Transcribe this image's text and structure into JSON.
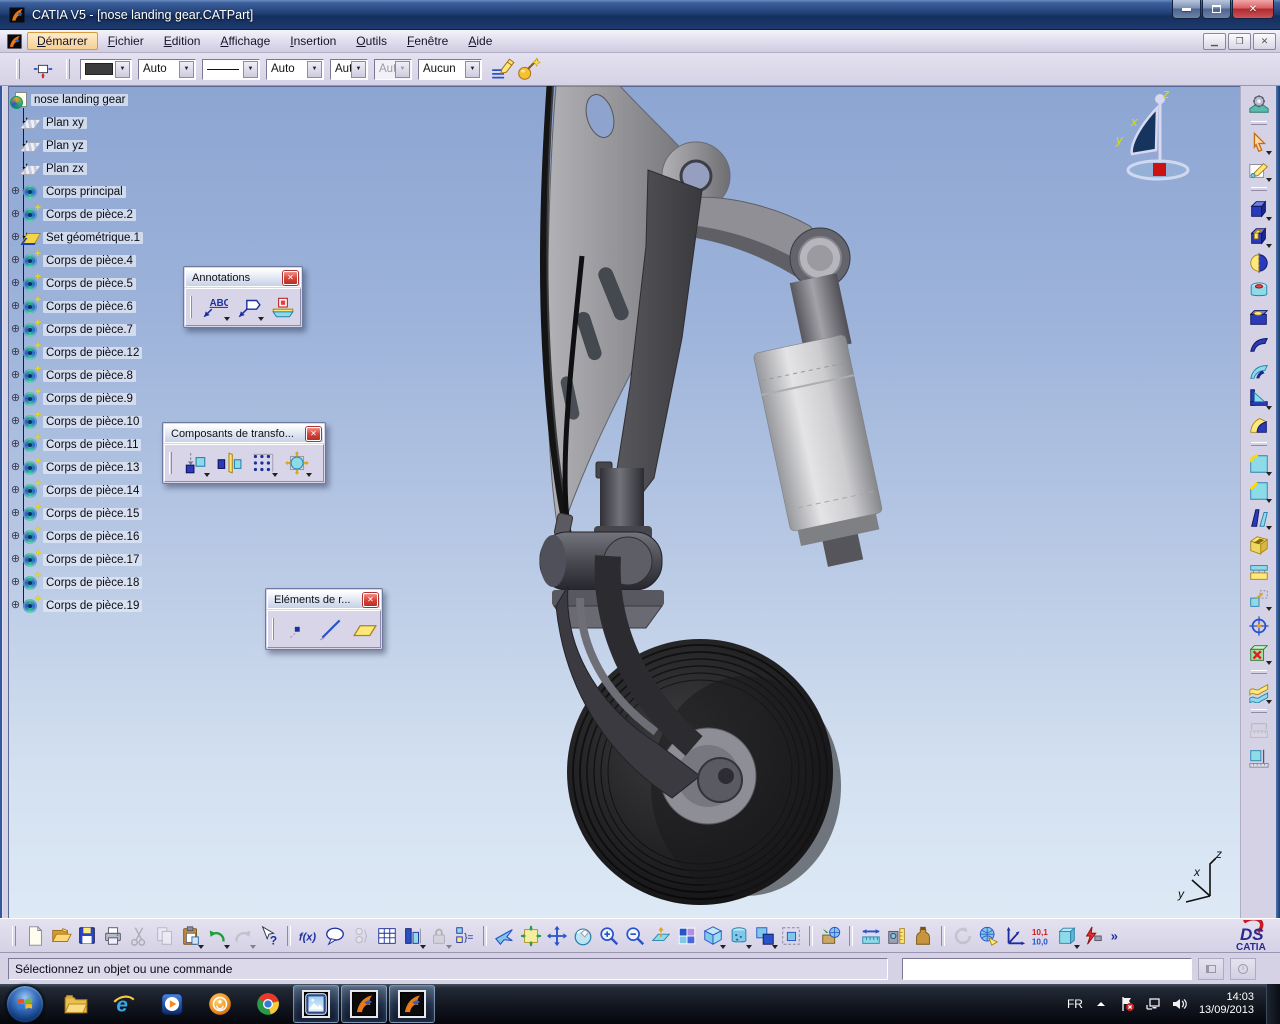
{
  "window": {
    "title": "CATIA V5 - [nose landing gear.CATPart]"
  },
  "menu": {
    "items": [
      {
        "label": "Démarrer",
        "cls": "hl",
        "name": "menu-demarrer"
      },
      {
        "label": "Fichier",
        "name": "menu-fichier"
      },
      {
        "label": "Edition",
        "name": "menu-edition"
      },
      {
        "label": "Affichage",
        "name": "menu-affichage"
      },
      {
        "label": "Insertion",
        "name": "menu-insertion"
      },
      {
        "label": "Outils",
        "name": "menu-outils"
      },
      {
        "label": "Fenêtre",
        "name": "menu-fenetre"
      },
      {
        "label": "Aide",
        "name": "menu-aide"
      }
    ]
  },
  "graphic_toolbar": {
    "combos": [
      {
        "name": "fill-color-combo",
        "cls": "swatch sw",
        "value": ""
      },
      {
        "name": "transparency-combo",
        "cls": "m",
        "value": "Auto"
      },
      {
        "name": "line-type-combo",
        "cls": "line m",
        "value": ""
      },
      {
        "name": "line-weight-combo",
        "cls": "m",
        "value": "Auto"
      },
      {
        "name": "point-style-combo",
        "cls": "s",
        "value": "Aut"
      },
      {
        "name": "render-style-combo",
        "cls": "s disabled",
        "value": "Aut"
      },
      {
        "name": "layer-combo",
        "cls": "l",
        "value": "Aucun"
      }
    ]
  },
  "tree": {
    "root": {
      "label": "nose landing gear"
    },
    "items": [
      {
        "label": "Plan xy",
        "icon": "plane",
        "expcls": "hide",
        "name": "tree-plan-xy"
      },
      {
        "label": "Plan yz",
        "icon": "plane",
        "expcls": "hide",
        "name": "tree-plan-yz"
      },
      {
        "label": "Plan zx",
        "icon": "plane",
        "expcls": "hide",
        "name": "tree-plan-zx"
      },
      {
        "label": "Corps principal",
        "icon": "body",
        "expcls": "show",
        "name": "tree-corps-principal"
      },
      {
        "label": "Corps de pièce.2",
        "icon": "bodyplus",
        "expcls": "show",
        "name": "tree-corps-2"
      },
      {
        "label": "Set géométrique.1",
        "icon": "geoset",
        "expcls": "show",
        "name": "tree-set-geometrique-1"
      },
      {
        "label": "Corps de pièce.4",
        "icon": "bodyplus",
        "expcls": "show",
        "name": "tree-corps-4"
      },
      {
        "label": "Corps de pièce.5",
        "icon": "bodyplus",
        "expcls": "show",
        "name": "tree-corps-5"
      },
      {
        "label": "Corps de pièce.6",
        "icon": "bodyplus",
        "expcls": "show",
        "name": "tree-corps-6"
      },
      {
        "label": "Corps de pièce.7",
        "icon": "bodyplus",
        "expcls": "show",
        "name": "tree-corps-7"
      },
      {
        "label": "Corps de pièce.12",
        "icon": "bodyplus",
        "expcls": "show",
        "name": "tree-corps-12"
      },
      {
        "label": "Corps de pièce.8",
        "icon": "bodyplus",
        "expcls": "show",
        "name": "tree-corps-8"
      },
      {
        "label": "Corps de pièce.9",
        "icon": "bodyplus",
        "expcls": "show",
        "name": "tree-corps-9"
      },
      {
        "label": "Corps de pièce.10",
        "icon": "bodyplus",
        "expcls": "show",
        "name": "tree-corps-10"
      },
      {
        "label": "Corps de pièce.11",
        "icon": "bodyplus",
        "expcls": "show",
        "name": "tree-corps-11"
      },
      {
        "label": "Corps de pièce.13",
        "icon": "bodyplus",
        "expcls": "show",
        "name": "tree-corps-13"
      },
      {
        "label": "Corps de pièce.14",
        "icon": "bodyplus",
        "expcls": "show",
        "name": "tree-corps-14"
      },
      {
        "label": "Corps de pièce.15",
        "icon": "bodyplus",
        "expcls": "show",
        "name": "tree-corps-15"
      },
      {
        "label": "Corps de pièce.16",
        "icon": "bodyplus",
        "expcls": "show",
        "name": "tree-corps-16"
      },
      {
        "label": "Corps de pièce.17",
        "icon": "bodyplus",
        "expcls": "show",
        "name": "tree-corps-17"
      },
      {
        "label": "Corps de pièce.18",
        "icon": "bodyplus",
        "expcls": "show",
        "name": "tree-corps-18"
      },
      {
        "label": "Corps de pièce.19",
        "icon": "bodyplus",
        "expcls": "show",
        "name": "tree-corps-19"
      }
    ]
  },
  "panels": {
    "annotations": {
      "title": "Annotations",
      "items": [
        {
          "icon": "a-text",
          "name": "text-with-leader-icon",
          "cls": "arr"
        },
        {
          "icon": "a-flag",
          "name": "flag-note-icon",
          "cls": "arr"
        },
        {
          "icon": "a-datum",
          "name": "datum-target-icon"
        }
      ]
    },
    "transform": {
      "title": "Composants de transfo...",
      "items": [
        {
          "icon": "t-translate",
          "name": "translation-icon",
          "cls": "arr"
        },
        {
          "icon": "t-mirror",
          "name": "mirror-icon"
        },
        {
          "icon": "t-pattern",
          "name": "rectangular-pattern-icon",
          "cls": "arr"
        },
        {
          "icon": "t-scale",
          "name": "scaling-icon",
          "cls": "arr"
        }
      ]
    },
    "reference": {
      "title": "Eléments de r...",
      "items": [
        {
          "icon": "e-point",
          "name": "point-icon"
        },
        {
          "icon": "e-line",
          "name": "line-icon"
        },
        {
          "icon": "e-plane",
          "name": "plane-icon"
        }
      ]
    }
  },
  "toolbar_left_icons": [
    {
      "icon": "i-selsets",
      "name": "selection-sets-icon"
    }
  ],
  "toolbar_right_of_combos": [
    {
      "icon": "i-painter",
      "name": "graphic-properties-painter-icon"
    },
    {
      "icon": "i-wizard",
      "name": "graphic-properties-wizard-icon"
    }
  ],
  "right_toolbar": {
    "items": [
      {
        "icon": "r-workbench",
        "name": "part-design-workbench-icon"
      },
      {
        "sep": true
      },
      {
        "icon": "r-select",
        "name": "select-icon",
        "cls": "arr"
      },
      {
        "icon": "r-sketcher",
        "name": "sketcher-icon",
        "cls": "arr"
      },
      {
        "sep": true
      },
      {
        "icon": "r-pad",
        "name": "pad-icon",
        "cls": "arr"
      },
      {
        "icon": "r-pocket",
        "name": "pocket-icon",
        "cls": "arr"
      },
      {
        "icon": "r-shaft",
        "name": "shaft-icon"
      },
      {
        "icon": "r-groove",
        "name": "groove-icon"
      },
      {
        "icon": "r-hole",
        "name": "hole-icon"
      },
      {
        "icon": "r-rib",
        "name": "rib-icon"
      },
      {
        "icon": "r-slot",
        "name": "slot-icon"
      },
      {
        "icon": "r-stiffener",
        "name": "stiffener-icon",
        "cls": "arr"
      },
      {
        "icon": "r-loft",
        "name": "multi-sections-solid-icon"
      },
      {
        "sep": true
      },
      {
        "icon": "r-fillet",
        "name": "edge-fillet-icon",
        "cls": "arr"
      },
      {
        "icon": "r-chamfer",
        "name": "chamfer-icon",
        "cls": "arr"
      },
      {
        "icon": "r-draft",
        "name": "draft-angle-icon",
        "cls": "arr"
      },
      {
        "icon": "r-shell",
        "name": "shell-icon"
      },
      {
        "icon": "r-thickness",
        "name": "thickness-icon"
      },
      {
        "icon": "r-transform",
        "name": "transformation-feature-icon",
        "cls": "arr"
      },
      {
        "icon": "r-axistarget",
        "name": "axis-system-icon"
      },
      {
        "icon": "r-remove",
        "name": "remove-body-icon",
        "cls": "arr"
      },
      {
        "sep": true
      },
      {
        "icon": "r-sew",
        "name": "sew-surface-icon",
        "cls": "arr"
      },
      {
        "sep": true
      },
      {
        "icon": "r-measure1",
        "name": "measure-between-icon",
        "cls": "dim"
      },
      {
        "icon": "r-measure2",
        "name": "measure-item-icon"
      }
    ]
  },
  "bottom_toolbar": {
    "items": [
      {
        "icon": "i-new",
        "name": "new-icon"
      },
      {
        "icon": "i-open",
        "name": "open-icon"
      },
      {
        "icon": "i-save",
        "name": "save-icon"
      },
      {
        "icon": "i-print",
        "name": "print-icon"
      },
      {
        "icon": "i-cut",
        "name": "cut-icon",
        "cls": "dim"
      },
      {
        "icon": "i-copy",
        "name": "copy-icon",
        "cls": "dim"
      },
      {
        "icon": "i-paste",
        "name": "paste-icon",
        "cls": "arr"
      },
      {
        "icon": "i-undo",
        "name": "undo-icon",
        "cls": "arr"
      },
      {
        "icon": "i-redo",
        "name": "redo-icon",
        "cls": "dim arr"
      },
      {
        "icon": "i-whatsthis",
        "name": "whats-this-help-icon"
      },
      {
        "sep": true
      },
      {
        "icon": "i-formula",
        "name": "formula-icon"
      },
      {
        "icon": "i-comment",
        "name": "comment-icon"
      },
      {
        "icon": "i-check8",
        "name": "knowledge-inspector-icon",
        "cls": "dim"
      },
      {
        "icon": "i-table",
        "name": "design-table-icon"
      },
      {
        "icon": "i-column",
        "name": "rule-icon",
        "cls": "arr"
      },
      {
        "icon": "i-lock",
        "name": "lock-icon",
        "cls": "dim arr"
      },
      {
        "icon": "i-relations",
        "name": "relations-icon"
      },
      {
        "sep": true
      },
      {
        "icon": "i-fly",
        "name": "fly-mode-icon"
      },
      {
        "icon": "i-fitall",
        "name": "fit-all-in-icon"
      },
      {
        "icon": "i-pan",
        "name": "pan-icon"
      },
      {
        "icon": "i-rotate",
        "name": "rotate-icon"
      },
      {
        "icon": "i-zoomin",
        "name": "zoom-in-icon"
      },
      {
        "icon": "i-zoomout",
        "name": "zoom-out-icon"
      },
      {
        "icon": "i-normal",
        "name": "normal-view-icon"
      },
      {
        "icon": "i-multiview",
        "name": "multi-view-icon"
      },
      {
        "icon": "i-isoview",
        "name": "isometric-view-icon",
        "cls": "arr"
      },
      {
        "icon": "i-renderstyle",
        "name": "render-style-icon",
        "cls": "arr"
      },
      {
        "icon": "i-hideshow",
        "name": "hide-show-icon",
        "cls": "arr"
      },
      {
        "icon": "i-swapspace",
        "name": "swap-visible-space-icon"
      },
      {
        "sep": true
      },
      {
        "icon": "i-catalog",
        "name": "catalog-browser-icon"
      },
      {
        "sep": true
      },
      {
        "icon": "i-measbetween",
        "name": "measure-between-icon"
      },
      {
        "icon": "i-measitem",
        "name": "measure-item-icon"
      },
      {
        "icon": "i-inertia",
        "name": "measure-inertia-icon"
      },
      {
        "sep": true
      },
      {
        "icon": "i-update",
        "name": "update-all-icon",
        "cls": "dim"
      },
      {
        "icon": "i-knowledge",
        "name": "knowledge-icon"
      },
      {
        "icon": "i-axis",
        "name": "axis-system-icon"
      },
      {
        "icon": "i-params",
        "name": "parameters-icon"
      },
      {
        "icon": "i-volume",
        "name": "volume-icon",
        "cls": "arr"
      },
      {
        "icon": "i-electrical",
        "name": "electrical-icon"
      },
      {
        "icon": "i-chevrons",
        "name": "more-toolbars-icon"
      }
    ],
    "logo": {
      "ds": "DS",
      "catia": "CATIA"
    }
  },
  "status": {
    "message": "Sélectionnez un objet ou une commande"
  },
  "compass": {
    "x": "x",
    "y": "y",
    "z": "z"
  },
  "triad": {
    "x": "x",
    "y": "y",
    "z": "z"
  },
  "taskbar": {
    "apps": [
      {
        "icon": "s-explorer",
        "name": "taskbar-windows-explorer"
      },
      {
        "icon": "s-ie",
        "name": "taskbar-internet-explorer"
      },
      {
        "icon": "s-wmp",
        "name": "taskbar-media-player"
      },
      {
        "icon": "s-gw",
        "name": "taskbar-groupwise"
      },
      {
        "icon": "s-chrome",
        "name": "taskbar-chrome"
      },
      {
        "icon": "s-photos",
        "name": "taskbar-photo-viewer",
        "cls": "active framed"
      },
      {
        "icon": "s-catia",
        "name": "taskbar-catia-1",
        "cls": "active framed"
      },
      {
        "icon": "s-catia",
        "name": "taskbar-catia-2",
        "cls": "active framed"
      }
    ],
    "tray": {
      "lang": "FR",
      "time": "14:03",
      "date": "13/09/2013"
    }
  },
  "colors": {
    "accent_orange": "#f7cf93",
    "toolbar_lavender": "#d6d2e6",
    "titlebar_blue": "#1f3d74",
    "viewport_top": "#8ca5d2",
    "viewport_bottom": "#dde9f5",
    "close_red": "#c9303a"
  }
}
